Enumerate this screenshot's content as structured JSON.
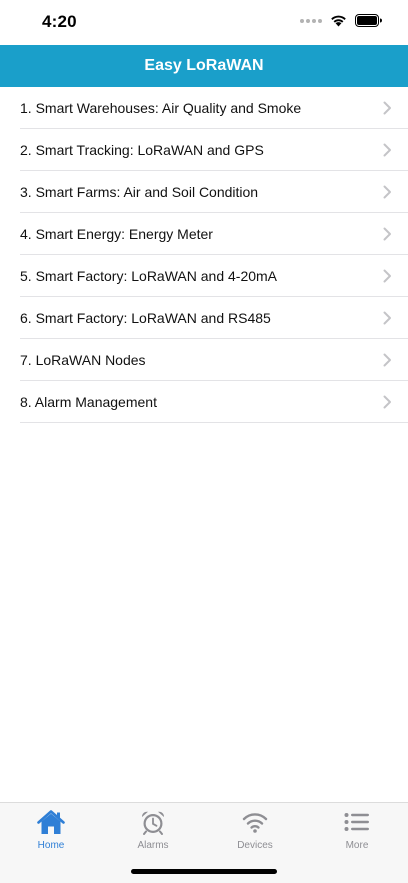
{
  "status_bar": {
    "time": "4:20"
  },
  "nav": {
    "title": "Easy LoRaWAN"
  },
  "menu": {
    "items": [
      {
        "label": "1. Smart Warehouses: Air Quality and Smoke"
      },
      {
        "label": "2. Smart Tracking: LoRaWAN and GPS"
      },
      {
        "label": "3. Smart Farms: Air and Soil Condition"
      },
      {
        "label": "4. Smart Energy: Energy Meter"
      },
      {
        "label": "5. Smart Factory: LoRaWAN and 4-20mA"
      },
      {
        "label": "6. Smart Factory: LoRaWAN and RS485"
      },
      {
        "label": "7. LoRaWAN Nodes"
      },
      {
        "label": "8. Alarm Management"
      }
    ]
  },
  "tab_bar": {
    "tabs": [
      {
        "label": "Home",
        "icon": "house-icon",
        "active": true
      },
      {
        "label": "Alarms",
        "icon": "alarm-clock-icon",
        "active": false
      },
      {
        "label": "Devices",
        "icon": "wifi-icon",
        "active": false
      },
      {
        "label": "More",
        "icon": "list-icon",
        "active": false
      }
    ]
  },
  "colors": {
    "nav_background": "#1a9fca",
    "tab_active": "#2f7fd6",
    "tab_inactive": "#8e8e93"
  }
}
